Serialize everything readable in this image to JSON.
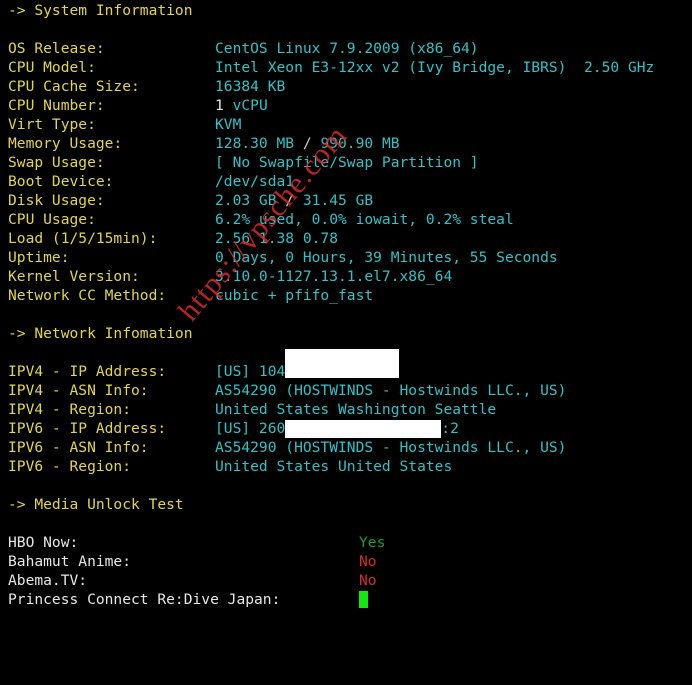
{
  "system": {
    "heading": "-> System Information",
    "rows": [
      {
        "label": "OS Release:",
        "value": "CentOS Linux 7.9.2009 (x86_64)"
      },
      {
        "label": "CPU Model:",
        "value": "Intel Xeon E3-12xx v2 (Ivy Bridge, IBRS)  2.50 GHz"
      },
      {
        "label": "CPU Cache Size:",
        "value": "16384 KB"
      },
      {
        "label": "CPU Number:",
        "count": "1",
        "unit": " vCPU"
      },
      {
        "label": "Virt Type:",
        "value": "KVM"
      },
      {
        "label": "Memory Usage:",
        "used": "128.30 MB",
        "sep": " / ",
        "total": "990.90 MB"
      },
      {
        "label": "Swap Usage:",
        "value": "[ No Swapfile/Swap Partition ]"
      },
      {
        "label": "Boot Device:",
        "value": "/dev/sda1"
      },
      {
        "label": "Disk Usage:",
        "used": "2.03 GB",
        "sep": " / ",
        "total": "31.45 GB"
      },
      {
        "label": "CPU Usage:",
        "value": "6.2% used, 0.0% iowait, 0.2% steal"
      },
      {
        "label": "Load (1/5/15min):",
        "value": "2.56 1.38 0.78"
      },
      {
        "label": "Uptime:",
        "value": "0 Days, 0 Hours, 39 Minutes, 55 Seconds"
      },
      {
        "label": "Kernel Version:",
        "value": "3.10.0-1127.13.1.el7.x86_64"
      },
      {
        "label": "Network CC Method:",
        "value": "cubic + pfifo_fast"
      }
    ]
  },
  "network": {
    "heading": "-> Network Infomation",
    "rows": [
      {
        "label": "IPV4 - IP Address:",
        "prefix": "[US] 104",
        "suffix": ""
      },
      {
        "label": "IPV4 - ASN Info:",
        "value": "AS54290 (HOSTWINDS - Hostwinds LLC., US)"
      },
      {
        "label": "IPV4 - Region:",
        "value": "United States Washington Seattle"
      },
      {
        "label": "IPV6 - IP Address:",
        "prefix": "[US] 260",
        "suffix": ":2"
      },
      {
        "label": "IPV6 - ASN Info:",
        "value": "AS54290 (HOSTWINDS - Hostwinds LLC., US)"
      },
      {
        "label": "IPV6 - Region:",
        "value": "United States United States"
      }
    ]
  },
  "media": {
    "heading": "-> Media Unlock Test",
    "rows": [
      {
        "label": "HBO Now:",
        "value": "Yes"
      },
      {
        "label": "Bahamut Anime:",
        "value": "No"
      },
      {
        "label": "Abema.TV:",
        "value": "No"
      },
      {
        "label": "Princess Connect Re:Dive Japan:",
        "value": ""
      }
    ]
  },
  "watermark": "https://vpsche.com",
  "colors": {
    "background": "#000000",
    "label": "#e3d54a",
    "value": "#2fc2c7",
    "yes": "#1f9d33",
    "no": "#d42c2c",
    "cursor": "#11e811",
    "watermark": "#dc2828"
  }
}
